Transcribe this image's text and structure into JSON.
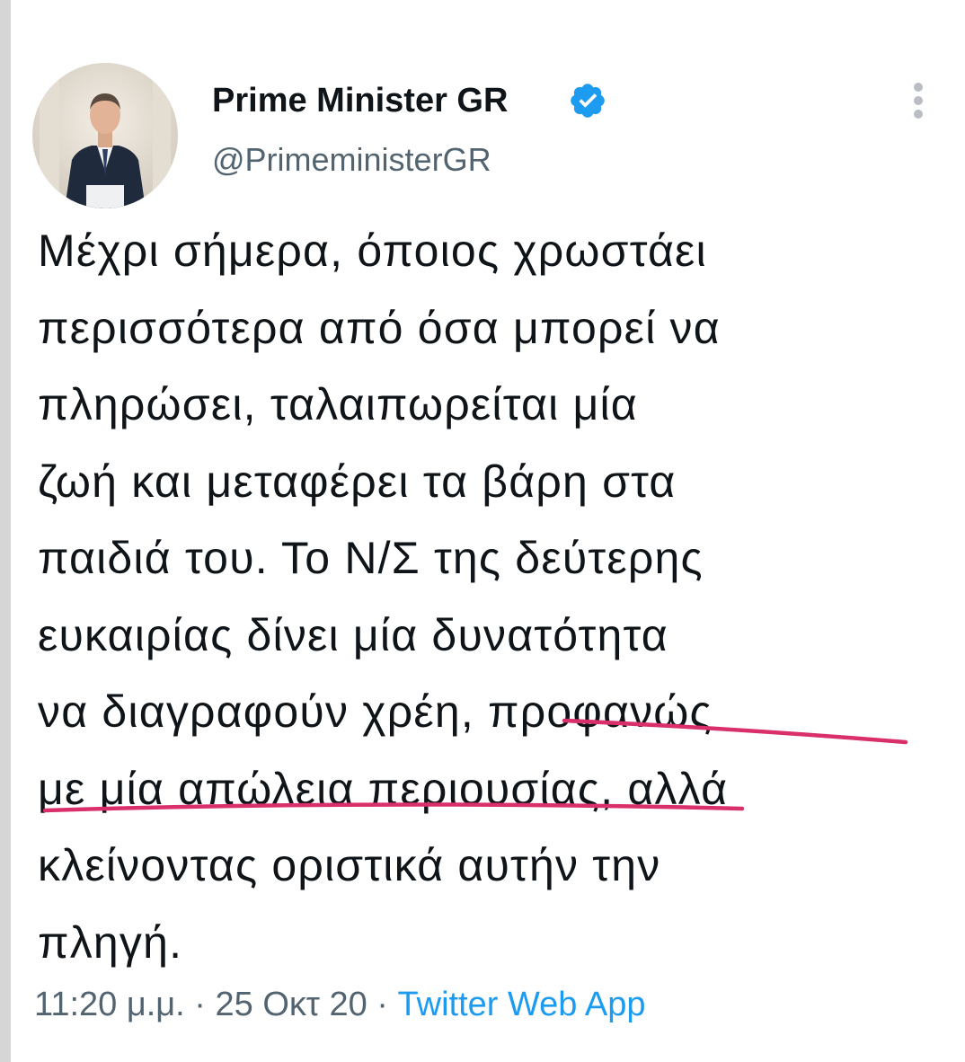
{
  "tweet": {
    "author": {
      "display_name": "Prime Minister GR",
      "handle": "@PrimeministerGR",
      "verified": true,
      "avatar_icon": "profile-photo-man-in-suit"
    },
    "text": "Μέχρι σήμερα, όποιος χρωστάει\nπερισσότερα από όσα μπορεί να\nπληρώσει, ταλαιπωρείται μία\nζωή και μεταφέρει τα βάρη στα\nπαιδιά του. Το Ν/Σ της δεύτερης\nευκαιρίας δίνει μία δυνατότητα\nνα διαγραφούν χρέη, προφανώς\nμε μία απώλεια περιουσίας, αλλά\nκλείνοντας οριστικά αυτήν την\nπληγή.",
    "time": "11:20 μ.μ.",
    "separator": "·",
    "date": "25 Οκτ 20",
    "source": "Twitter Web App"
  },
  "colors": {
    "text": "#0f1419",
    "secondary": "#536471",
    "link": "#1d9bf0",
    "verified": "#1d9bf0",
    "annotation_underline": "#d9306b"
  },
  "icons": {
    "verified": "verified-badge-icon",
    "more": "more-options-icon"
  }
}
